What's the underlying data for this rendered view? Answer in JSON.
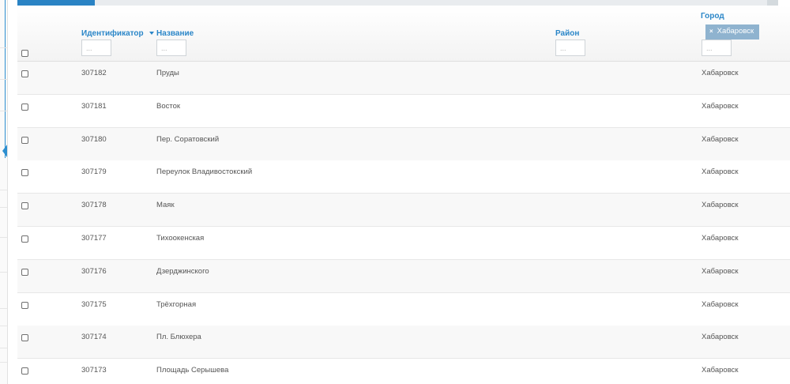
{
  "columns": {
    "id_label": "Идентификатор",
    "name_label": "Название",
    "district_label": "Район",
    "city_label": "Город"
  },
  "filters": {
    "id_placeholder": "...",
    "name_placeholder": "...",
    "district_placeholder": "...",
    "city_placeholder": "...",
    "city_chip_label": "Хабаровск",
    "city_chip_remove": "×"
  },
  "rows": [
    {
      "id": "307182",
      "name": "Пруды",
      "district": "",
      "city": "Хабаровск"
    },
    {
      "id": "307181",
      "name": "Восток",
      "district": "",
      "city": "Хабаровск"
    },
    {
      "id": "307180",
      "name": "Пер. Соратовский",
      "district": "",
      "city": "Хабаровск"
    },
    {
      "id": "307179",
      "name": "Переулок Владивостокский",
      "district": "",
      "city": "Хабаровск"
    },
    {
      "id": "307178",
      "name": "Маяк",
      "district": "",
      "city": "Хабаровск"
    },
    {
      "id": "307177",
      "name": "Тихоокенская",
      "district": "",
      "city": "Хабаровск"
    },
    {
      "id": "307176",
      "name": "Дзерджинского",
      "district": "",
      "city": "Хабаровск"
    },
    {
      "id": "307175",
      "name": "Трёхгорная",
      "district": "",
      "city": "Хабаровск"
    },
    {
      "id": "307174",
      "name": "Пл. Блюхера",
      "district": "",
      "city": "Хабаровск"
    },
    {
      "id": "307173",
      "name": "Площадь Серышева",
      "district": "",
      "city": "Хабаровск"
    }
  ],
  "colors": {
    "accent": "#2a86c8",
    "chip_bg": "#8fb3cf",
    "row_alt": "#f8f8f8"
  }
}
